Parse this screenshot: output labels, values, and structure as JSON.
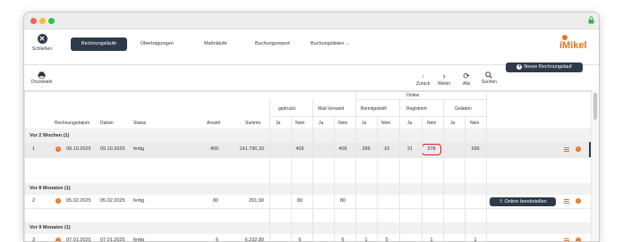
{
  "nav": {
    "close_label": "Schließen",
    "tabs": [
      {
        "label": "Rechnungsläufe"
      },
      {
        "label": "Übertragungen"
      },
      {
        "label": "Mahnläufe"
      },
      {
        "label": "Buchungsreport"
      },
      {
        "label": "Buchungslisten ..."
      }
    ],
    "logo_text": "iMikel"
  },
  "toolbar": {
    "print_label": "Druckwahl",
    "back_label": "Zurück",
    "next_label": "Weiter",
    "all_label": "Alle",
    "search_label": "Suchen",
    "new_label": "Neuer Rechnungslauf"
  },
  "columns": {
    "online": "Online",
    "gedruckt": "gedruckt",
    "mail": "Mail-Versand",
    "bereitgestellt": "Bereitgestellt",
    "registriert": "Registriert",
    "geladen": "Geladen",
    "ja": "Ja",
    "nein": "Nein",
    "rechnungsdatum": "Rechnungsdatum",
    "datum": "Datum",
    "status": "Status",
    "anzahl": "Anzahl",
    "summe": "Summe"
  },
  "groups": [
    {
      "label": "Vor 2 Wochen (1)",
      "row": {
        "num": "1",
        "rdate": "09.10.2025",
        "date": "09.10.2025",
        "status": "fertig",
        "anzahl": "409",
        "summe": "141.796,33",
        "g_nein": "409",
        "m_nein": "409",
        "b_ja": "399",
        "b_nein": "10",
        "r_ja": "21",
        "r_nein": "378",
        "l_nein": "399"
      }
    },
    {
      "label": "Vor 8 Monaten (1)",
      "row": {
        "num": "2",
        "rdate": "05.02.2025",
        "date": "05.02.2025",
        "status": "fertig",
        "anzahl": "80",
        "summe": "261,90",
        "g_nein": "80",
        "m_nein": "80"
      },
      "action_label": "Online bereitstellen"
    },
    {
      "label": "Vor 9 Monaten (1)",
      "row": {
        "num": "3",
        "rdate": "07.01.2025",
        "date": "07.01.2025",
        "status": "fertig",
        "anzahl": "6",
        "summe": "6.232,80",
        "g_nein": "6",
        "m_nein": "6",
        "b_ja": "1",
        "b_nein": "5",
        "r_nein": "1",
        "l_nein": "1"
      }
    }
  ],
  "colors": {
    "accent": "#2d3a4a",
    "orange": "#e8731e",
    "highlight": "#e01b1b"
  }
}
